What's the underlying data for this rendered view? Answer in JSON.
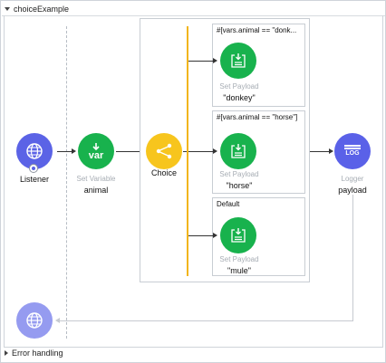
{
  "flow": {
    "name": "choiceExample",
    "error_handling_label": "Error handling"
  },
  "listener": {
    "label": "Listener"
  },
  "set_variable": {
    "type_label": "Set Variable",
    "name": "animal",
    "icon_text": "var"
  },
  "choice": {
    "label": "Choice"
  },
  "routes": [
    {
      "condition": "#[vars.animal == \"donk...",
      "processor": "Set Payload",
      "value": "\"donkey\""
    },
    {
      "condition": "#[vars.animal == \"horse\"]",
      "processor": "Set Payload",
      "value": "\"horse\""
    },
    {
      "condition": "Default",
      "processor": "Set Payload",
      "value": "\"mule\""
    }
  ],
  "logger": {
    "type_label": "Logger",
    "name": "payload",
    "icon_text": "LOG"
  },
  "colors": {
    "listener": "#5b63e6",
    "set_payload": "#18b24d",
    "choice": "#f7c51d",
    "logger": "#5a61e8",
    "choice_bar": "#f2b51b"
  }
}
